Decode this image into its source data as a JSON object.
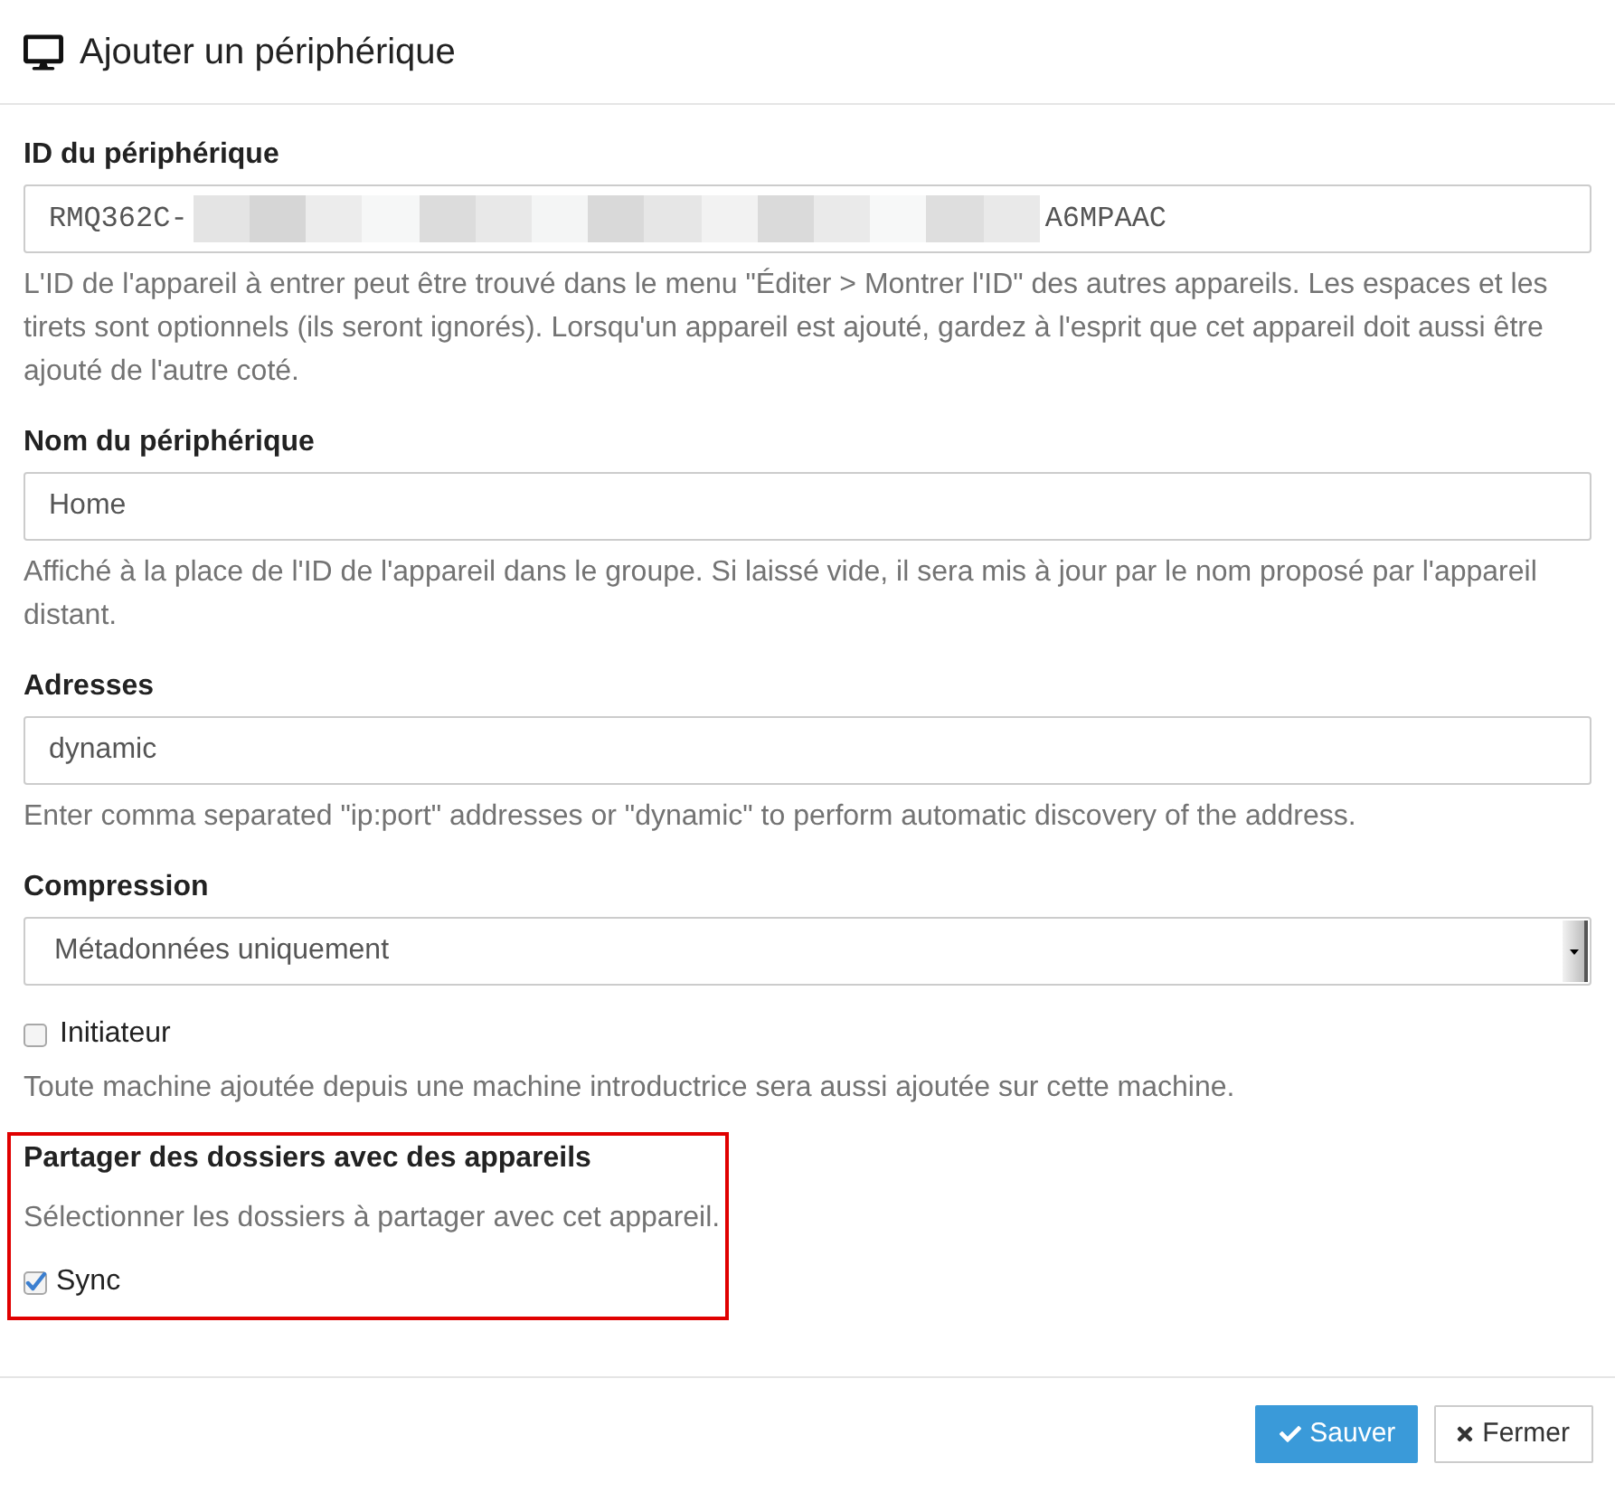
{
  "dialog": {
    "title": "Ajouter un périphérique"
  },
  "fields": [
    {
      "kind": "device_id",
      "label": "ID du périphérique",
      "value_start": "RMQ362C-",
      "redacted": true,
      "value_end": "A6MPAAC",
      "help": "L'ID de l'appareil à entrer peut être trouvé dans le menu \"Éditer > Montrer l'ID\" des autres appareils. Les espaces et les tirets sont optionnels (ils seront ignorés). Lorsqu'un appareil est ajouté, gardez à l'esprit que cet appareil doit aussi être ajouté de l'autre coté."
    },
    {
      "kind": "text",
      "label": "Nom du périphérique",
      "value": "Home",
      "help": "Affiché à la place de l'ID de l'appareil dans le groupe. Si laissé vide, il sera mis à jour par le nom proposé par l'appareil distant."
    },
    {
      "kind": "text",
      "label": "Adresses",
      "value": "dynamic",
      "help": "Enter comma separated \"ip:port\" addresses or \"dynamic\" to perform automatic discovery of the address."
    },
    {
      "kind": "select",
      "label": "Compression",
      "value": "Métadonnées uniquement"
    },
    {
      "kind": "checkbox",
      "label": "Initiateur",
      "checked": false,
      "help": "Toute machine ajoutée depuis une machine introductrice sera aussi ajoutée sur cette machine."
    }
  ],
  "share_section": {
    "highlighted": true,
    "title": "Partager des dossiers avec des appareils",
    "help": "Sélectionner les dossiers à partager avec cet appareil.",
    "folders": [
      {
        "label": "Sync",
        "checked": true
      }
    ]
  },
  "buttons": [
    {
      "kind": "primary",
      "label": "Sauver"
    },
    {
      "kind": "default",
      "label": "Fermer"
    }
  ]
}
